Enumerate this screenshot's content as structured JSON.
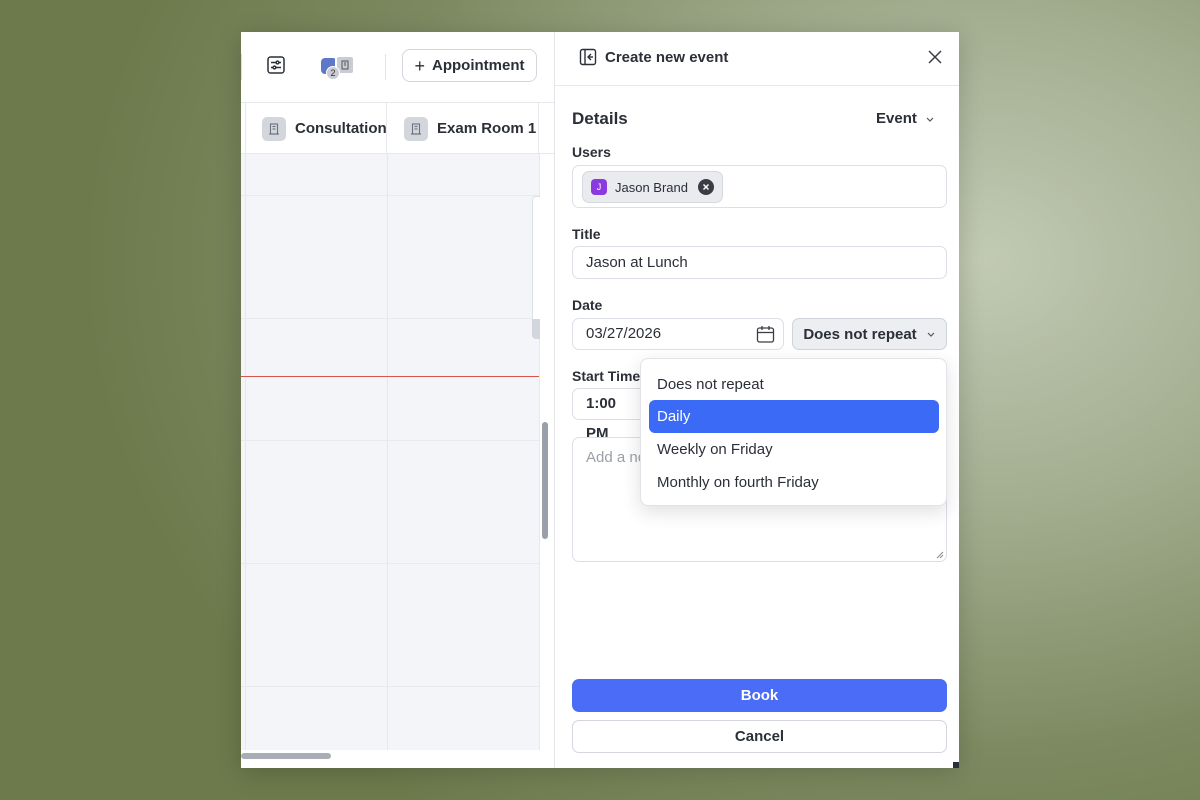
{
  "toolbar": {
    "filter_icon": "sliders-icon",
    "resources_count": "2",
    "add_appointment_label": "Appointment"
  },
  "calendar": {
    "columns": [
      {
        "label": "Consultation Room",
        "icon": "room-icon"
      },
      {
        "label": "Exam Room 1",
        "icon": "room-icon"
      }
    ],
    "now_line_color": "#d9534f"
  },
  "panel": {
    "title": "Create new event",
    "section_title": "Details",
    "event_type": "Event",
    "users": {
      "label": "Users",
      "chips": [
        {
          "initial": "J",
          "name": "Jason Brand"
        }
      ]
    },
    "title_field": {
      "label": "Title",
      "value": "Jason at Lunch"
    },
    "date": {
      "label": "Date",
      "value": "03/27/2026",
      "repeat_value": "Does not repeat"
    },
    "start_time": {
      "label": "Start Time",
      "value": "1:00 PM"
    },
    "notes": {
      "placeholder": "Add a no"
    },
    "repeat_options": [
      "Does not repeat",
      "Daily",
      "Weekly on Friday",
      "Monthly on fourth Friday"
    ],
    "repeat_highlighted": "Daily",
    "book_label": "Book",
    "cancel_label": "Cancel"
  },
  "colors": {
    "accent": "#4a6cf7",
    "highlight": "#3b6bf6",
    "avatar": "#8a3be0"
  }
}
